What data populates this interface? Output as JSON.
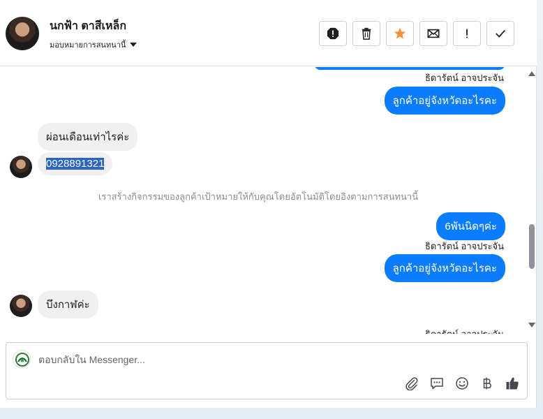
{
  "header": {
    "contact_name": "นกฟ้า ตาสีเหล็ก",
    "assign_label": "มอบหมายการสนทนานี้",
    "toolbar": [
      {
        "icon": "spam-icon"
      },
      {
        "icon": "trash-icon"
      },
      {
        "icon": "star-icon",
        "color": "#f7923b"
      },
      {
        "icon": "mail-icon"
      },
      {
        "icon": "follow-up-icon"
      },
      {
        "icon": "check-icon"
      }
    ]
  },
  "messages": {
    "sender_1": "ธิดารัตน์ อาจประจัน",
    "out_1": "ลูกค้าอยู่จังหวัดอะไรคะ",
    "in_1": "ผ่อนเดือนเท่าไรค่ะ",
    "in_2": "0928891321",
    "system_note": "เราสร้างกิจกรรมของลูกค้าเป้าหมายให้กับคุณโดยอัตโนมัติโดยอิงตามการสนทนานี้",
    "out_2": "6พันนิดๆค่ะ",
    "sender_2": "ธิดารัตน์ อาจประจัน",
    "out_3": "ลูกค้าอยู่จังหวัดอะไรคะ",
    "in_3": "บึงกาฬค่ะ",
    "sender_3": "ธิดารัตน์ อาจประจัน"
  },
  "composer": {
    "placeholder": "ตอบกลับใน Messenger...",
    "icons": [
      "attach-icon",
      "saved-reply-icon",
      "emoji-icon",
      "payment-baht-icon",
      "thumbs-up-icon"
    ]
  },
  "colors": {
    "outgoing_bubble": "#0a7cff",
    "incoming_bubble": "#f0f0f0",
    "accent_star": "#f7923b"
  }
}
